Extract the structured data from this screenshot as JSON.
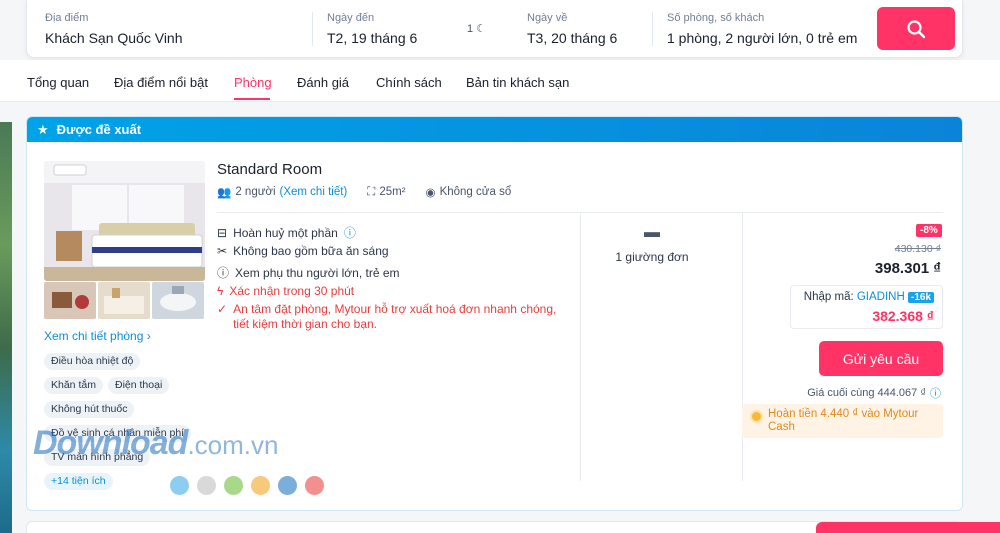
{
  "search": {
    "location_label": "Địa điểm",
    "location_value": "Khách Sạn Quốc Vinh",
    "checkin_label": "Ngày đến",
    "checkin_value": "T2, 19 tháng 6",
    "nights": "1",
    "checkout_label": "Ngày về",
    "checkout_value": "T3, 20 tháng 6",
    "guests_label": "Số phòng, số khách",
    "guests_value": "1 phòng, 2 người lớn, 0 trẻ em"
  },
  "tabs": [
    {
      "label": "Tổng quan"
    },
    {
      "label": "Địa điểm nổi bật"
    },
    {
      "label": "Phòng",
      "active": true
    },
    {
      "label": "Đánh giá"
    },
    {
      "label": "Chính sách"
    },
    {
      "label": "Bản tin khách sạn"
    }
  ],
  "card": {
    "header": "Được đề xuất",
    "detail_link": "Xem chi tiết phòng",
    "amenities": [
      "Điều hòa nhiệt độ",
      "Khăn tắm",
      "Điện thoại",
      "Không hút thuốc",
      "Đồ vệ sinh cá nhân miễn phí",
      "TV màn hình phẳng"
    ],
    "more_amenities": "+14 tiện ích",
    "room": {
      "name": "Standard Room",
      "occupancy": "2 người",
      "occupancy_link": "(Xem chi tiết)",
      "size": "25m²",
      "view": "Không cửa sổ"
    },
    "policies": [
      "Hoàn huỷ một phần",
      "Không bao gồm bữa ăn sáng",
      "Xem phụ thu người lớn, trẻ em",
      "Xác nhận trong 30 phút"
    ],
    "invoice_note": "An tâm đặt phòng, Mytour hỗ trợ xuất hoá đơn nhanh chóng, tiết kiệm thời gian cho bạn.",
    "bed": "1 giường đơn",
    "pricing": {
      "discount": "-8%",
      "original": "430.130 ₫",
      "price": "398.301 ₫",
      "promo_label": "Nhập mã:",
      "promo_code": "GIADINH",
      "promo_off": "-16k",
      "promo_price": "382.368 ₫",
      "request_button": "Gửi yêu cầu",
      "final_price": "Giá cuối cùng 444.067 ₫",
      "cashback": "Hoàn tiền 4.440 ₫ vào Mytour Cash"
    }
  },
  "watermark": {
    "main": "Download",
    "suffix": ".com.vn"
  },
  "colors": {
    "accent": "#ff3366",
    "link": "#0a8fd8",
    "header_blue": "#00a3e8",
    "dots": [
      "#8ecdf2",
      "#d9d9d9",
      "#a8d98a",
      "#f7c97a",
      "#7aaedc",
      "#f2908e"
    ]
  }
}
